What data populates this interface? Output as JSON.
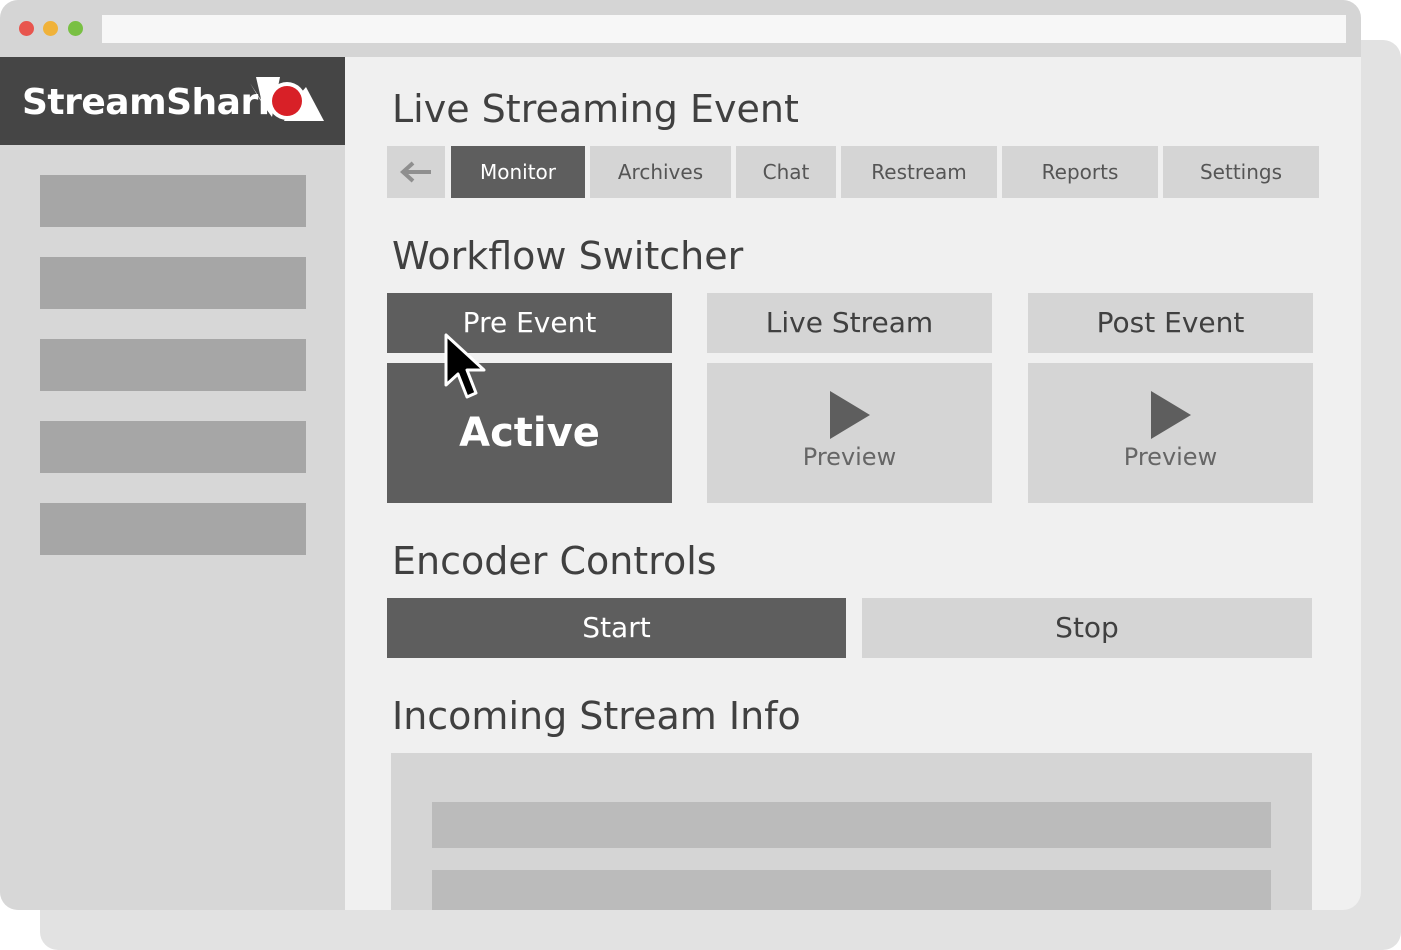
{
  "brand": {
    "name": "StreamShark",
    "logo_icon": "shark-fin-red-dot-icon"
  },
  "page": {
    "title": "Live Streaming Event"
  },
  "tabs": {
    "back_icon": "arrow-left-icon",
    "items": [
      "Monitor",
      "Archives",
      "Chat",
      "Restream",
      "Reports",
      "Settings"
    ],
    "active": "Monitor"
  },
  "workflow": {
    "title": "Workflow Switcher",
    "stages": [
      {
        "label": "Pre Event",
        "status": "Active"
      },
      {
        "label": "Live Stream",
        "preview_label": "Preview",
        "icon": "play-icon"
      },
      {
        "label": "Post Event",
        "preview_label": "Preview",
        "icon": "play-icon"
      }
    ]
  },
  "encoder": {
    "title": "Encoder Controls",
    "start_label": "Start",
    "stop_label": "Stop"
  },
  "stream_info": {
    "title": "Incoming Stream Info"
  },
  "colors": {
    "accent_dark": "#5e5e5e",
    "brand_bar": "#454545",
    "logo_red": "#d82027",
    "light_panel": "#d5d5d5"
  }
}
